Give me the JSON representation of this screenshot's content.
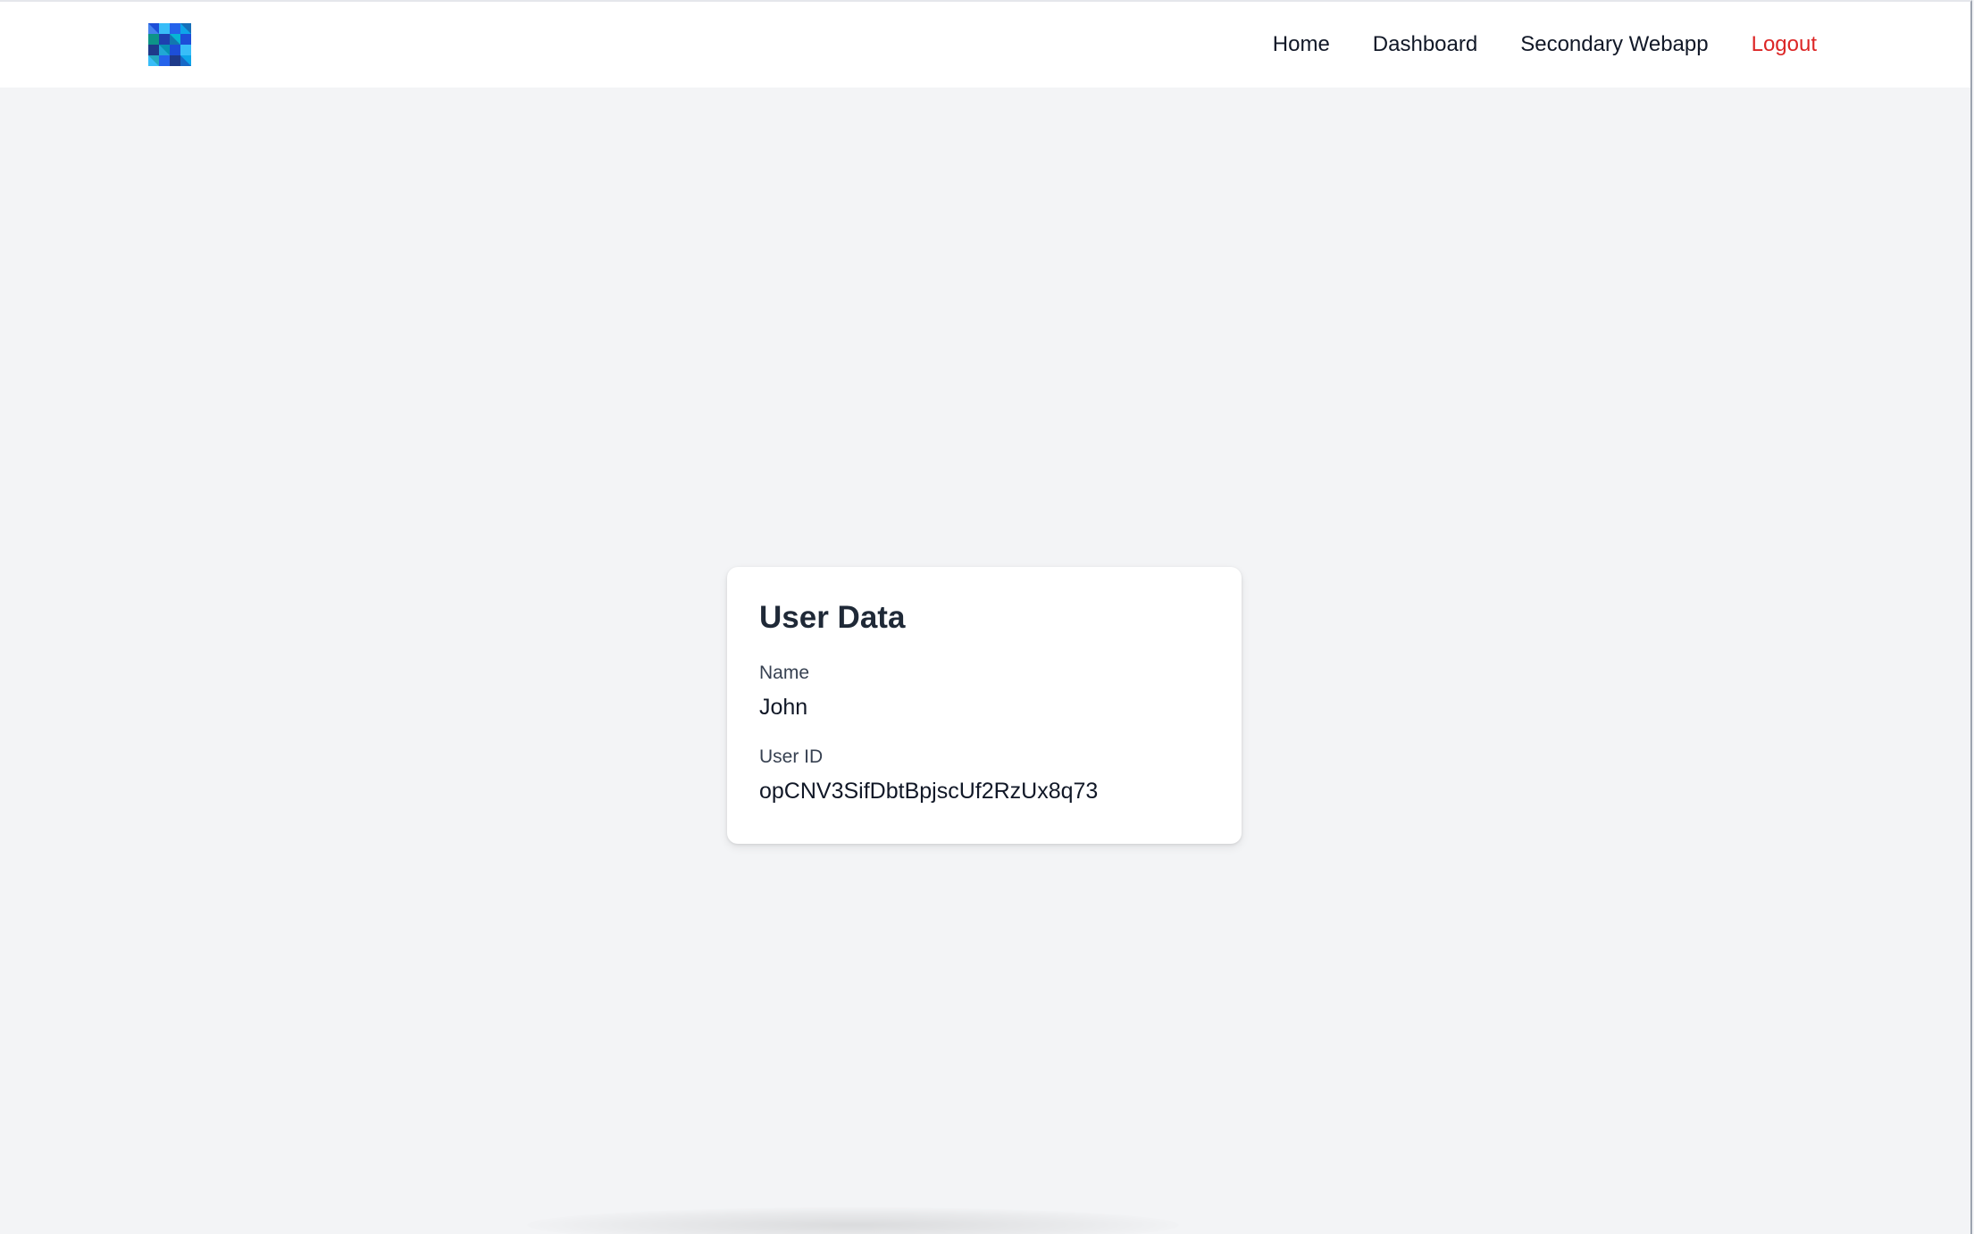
{
  "navbar": {
    "logo_icon": "mosaic-logo-icon",
    "links": [
      {
        "label": "Home"
      },
      {
        "label": "Dashboard"
      },
      {
        "label": "Secondary Webapp"
      },
      {
        "label": "Logout"
      }
    ]
  },
  "user_card": {
    "title": "User Data",
    "fields": [
      {
        "label": "Name",
        "value": "John"
      },
      {
        "label": "User ID",
        "value": "opCNV3SifDbtBpjscUf2RzUx8q73"
      }
    ]
  },
  "colors": {
    "background": "#f3f4f6",
    "navbar": "#ffffff",
    "logout": "#dc2626",
    "text": "#111827",
    "logo_dark": "#1e3a8a",
    "logo_light": "#38bdf8"
  }
}
